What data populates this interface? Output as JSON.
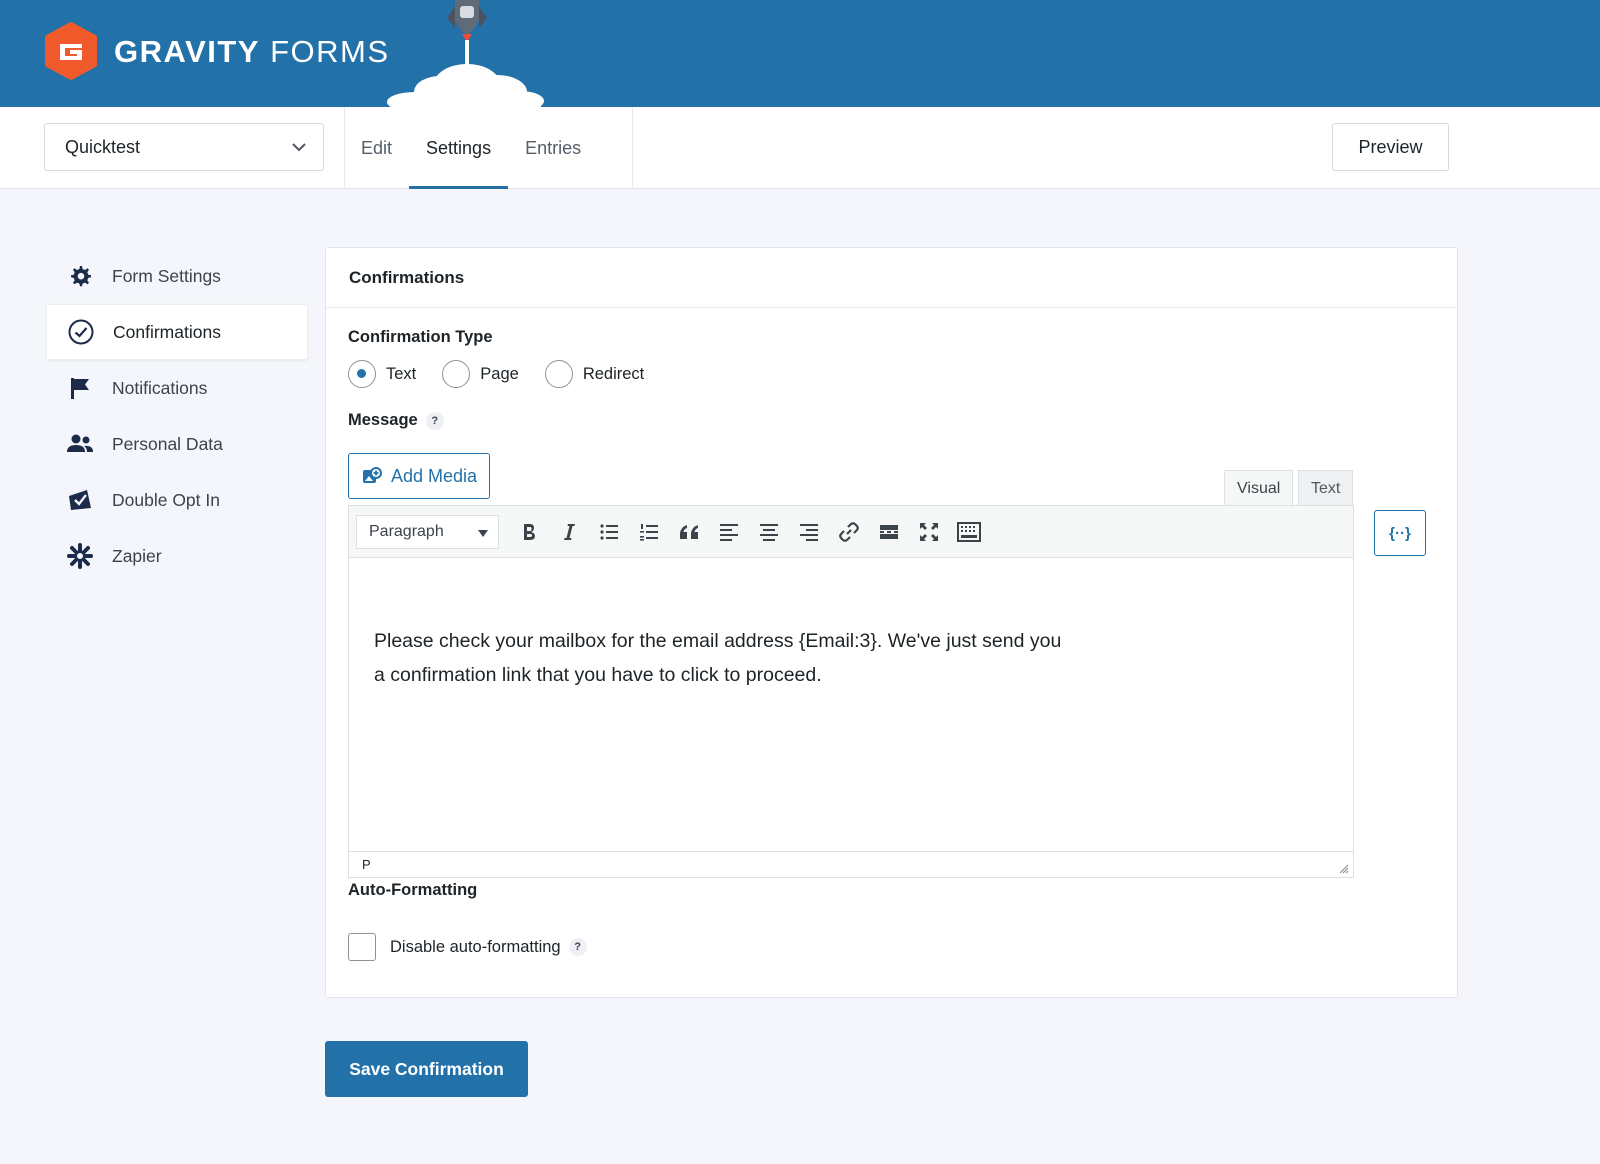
{
  "brand": {
    "name_bold": "GRAVITY",
    "name_light": "FORMS",
    "logo_color": "#f15a2b",
    "header_color": "#2271a8"
  },
  "toolbar": {
    "form_selector_value": "Quicktest",
    "tabs": [
      {
        "label": "Edit",
        "active": false
      },
      {
        "label": "Settings",
        "active": true
      },
      {
        "label": "Entries",
        "active": false
      }
    ],
    "preview_label": "Preview"
  },
  "sidebar": {
    "items": [
      {
        "label": "Form Settings",
        "icon": "gear-icon",
        "active": false
      },
      {
        "label": "Confirmations",
        "icon": "check-circle-icon",
        "active": true
      },
      {
        "label": "Notifications",
        "icon": "flag-icon",
        "active": false
      },
      {
        "label": "Personal Data",
        "icon": "users-icon",
        "active": false
      },
      {
        "label": "Double Opt In",
        "icon": "envelope-check-icon",
        "active": false
      },
      {
        "label": "Zapier",
        "icon": "asterisk-icon",
        "active": false
      }
    ]
  },
  "panel": {
    "title": "Confirmations",
    "confirmation_type_label": "Confirmation Type",
    "confirmation_type_options": [
      {
        "label": "Text",
        "checked": true
      },
      {
        "label": "Page",
        "checked": false
      },
      {
        "label": "Redirect",
        "checked": false
      }
    ],
    "message_label": "Message",
    "help_glyph": "?",
    "add_media_label": "Add Media",
    "editor_tabs": {
      "visual": "Visual",
      "text": "Text"
    },
    "format_select_value": "Paragraph",
    "message_line_1": "Please check your mailbox for the email address {Email:3}. We've just send you",
    "message_line_2": "a confirmation link that you have to click to proceed.",
    "status_path": "P",
    "merge_tag_glyph": "{··}",
    "auto_formatting_label": "Auto-Formatting",
    "disable_auto_formatting_label": "Disable auto-formatting"
  },
  "save_label": "Save Confirmation"
}
